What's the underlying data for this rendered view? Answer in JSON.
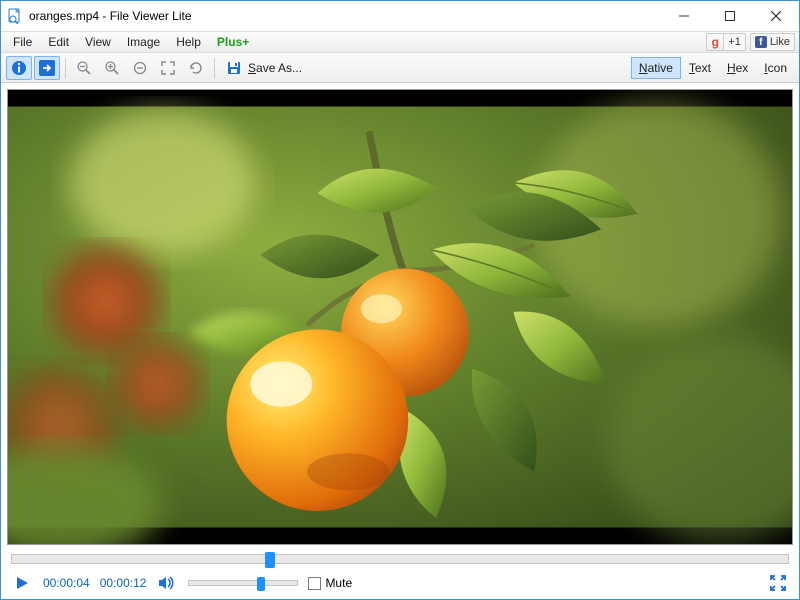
{
  "window": {
    "title": "oranges.mp4 - File Viewer Lite"
  },
  "menubar": {
    "file": "File",
    "edit": "Edit",
    "view": "View",
    "image": "Image",
    "help": "Help",
    "plus": "Plus+"
  },
  "social": {
    "gplus_count": "+1",
    "fb_label": "Like"
  },
  "toolbar": {
    "saveas_label": "Save As..."
  },
  "view_modes": {
    "native": "Native",
    "text": "Text",
    "hex": "Hex",
    "icon": "Icon",
    "active": "native"
  },
  "player": {
    "current_time": "00:00:04",
    "total_time": "00:00:12",
    "progress_fraction": 0.33,
    "volume_fraction": 0.68,
    "mute_label": "Mute",
    "muted": false
  },
  "colors": {
    "accent": "#1e90ff",
    "plus_green": "#1a9e1a",
    "window_border": "#3a93d6"
  }
}
